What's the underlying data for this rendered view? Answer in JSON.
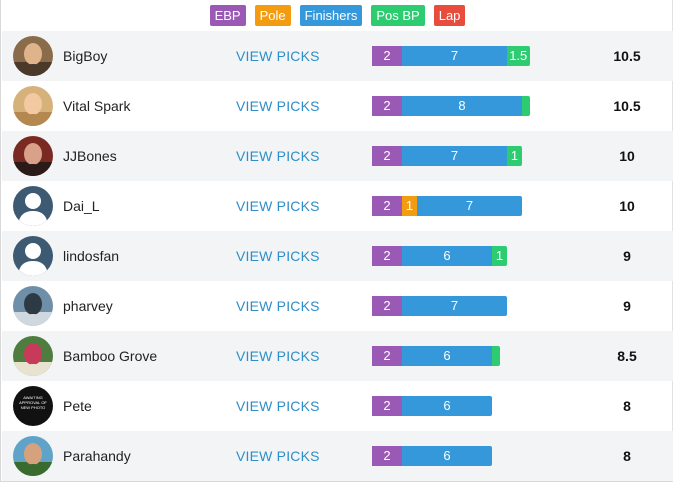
{
  "legend": [
    {
      "label": "EBP",
      "color": "#9b59b6"
    },
    {
      "label": "Pole",
      "color": "#f39c12"
    },
    {
      "label": "Finishers",
      "color": "#3498db"
    },
    {
      "label": "Pos BP",
      "color": "#2ecc71"
    },
    {
      "label": "Lap",
      "color": "#e74c3c"
    }
  ],
  "colors": {
    "ebp": "#9b59b6",
    "pole": "#f39c12",
    "finishers": "#3498db",
    "posbp": "#2ecc71",
    "lap": "#e74c3c"
  },
  "view_label": "VIEW PICKS",
  "rows": [
    {
      "name": "BigBoy",
      "avatar": "photo-avatar",
      "segments": [
        {
          "key": "ebp",
          "value": 2,
          "label": "2"
        },
        {
          "key": "finishers",
          "value": 7,
          "label": "7"
        },
        {
          "key": "posbp",
          "value": 1.5,
          "label": "1.5"
        }
      ],
      "score": "10.5"
    },
    {
      "name": "Vital Spark",
      "avatar": "photo-avatar",
      "segments": [
        {
          "key": "ebp",
          "value": 2,
          "label": "2"
        },
        {
          "key": "finishers",
          "value": 8,
          "label": "8"
        },
        {
          "key": "posbp",
          "value": 0.5,
          "label": ""
        }
      ],
      "score": "10.5"
    },
    {
      "name": "JJBones",
      "avatar": "photo-avatar",
      "segments": [
        {
          "key": "ebp",
          "value": 2,
          "label": "2"
        },
        {
          "key": "finishers",
          "value": 7,
          "label": "7"
        },
        {
          "key": "posbp",
          "value": 1,
          "label": "1"
        }
      ],
      "score": "10"
    },
    {
      "name": "Dai_L",
      "avatar": "default-user-avatar",
      "segments": [
        {
          "key": "ebp",
          "value": 2,
          "label": "2"
        },
        {
          "key": "pole",
          "value": 1,
          "label": "1"
        },
        {
          "key": "finishers",
          "value": 7,
          "label": "7"
        }
      ],
      "score": "10"
    },
    {
      "name": "lindosfan",
      "avatar": "default-user-avatar",
      "segments": [
        {
          "key": "ebp",
          "value": 2,
          "label": "2"
        },
        {
          "key": "finishers",
          "value": 6,
          "label": "6"
        },
        {
          "key": "posbp",
          "value": 1,
          "label": "1"
        }
      ],
      "score": "9"
    },
    {
      "name": "pharvey",
      "avatar": "photo-avatar",
      "segments": [
        {
          "key": "ebp",
          "value": 2,
          "label": "2"
        },
        {
          "key": "finishers",
          "value": 7,
          "label": "7"
        }
      ],
      "score": "9"
    },
    {
      "name": "Bamboo Grove",
      "avatar": "photo-avatar",
      "segments": [
        {
          "key": "ebp",
          "value": 2,
          "label": "2"
        },
        {
          "key": "finishers",
          "value": 6,
          "label": "6"
        },
        {
          "key": "posbp",
          "value": 0.5,
          "label": ""
        }
      ],
      "score": "8.5"
    },
    {
      "name": "Pete",
      "avatar": "photo-avatar",
      "avatar_text": "AWAITING APPROVAL OF NEW PHOTO",
      "segments": [
        {
          "key": "ebp",
          "value": 2,
          "label": "2"
        },
        {
          "key": "finishers",
          "value": 6,
          "label": "6"
        }
      ],
      "score": "8"
    },
    {
      "name": "Parahandy",
      "avatar": "photo-avatar",
      "segments": [
        {
          "key": "ebp",
          "value": 2,
          "label": "2"
        },
        {
          "key": "finishers",
          "value": 6,
          "label": "6"
        }
      ],
      "score": "8"
    }
  ]
}
